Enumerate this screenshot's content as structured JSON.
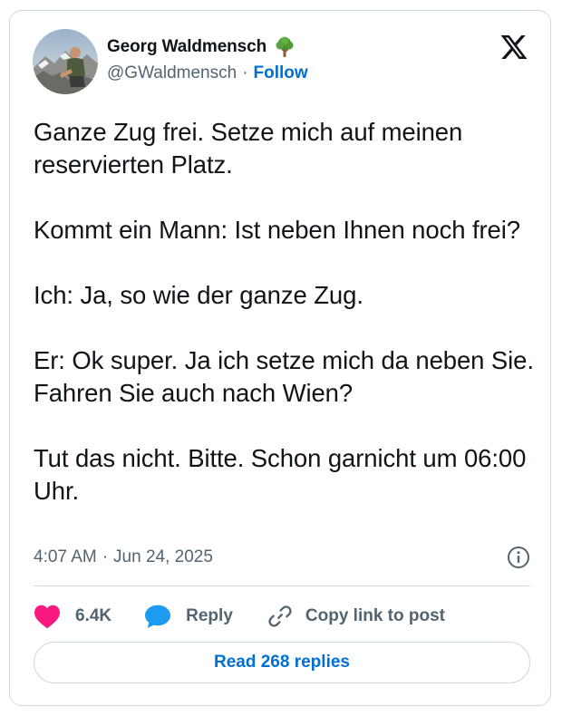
{
  "author": {
    "name": "Georg Waldmensch",
    "name_emoji": "deciduous-tree-icon",
    "handle": "@GWaldmensch",
    "separator": "·",
    "follow_label": "Follow"
  },
  "tweet": {
    "paragraphs": [
      "Ganze Zug frei. Setze mich auf meinen reservierten Platz.",
      "Kommt ein Mann: Ist neben Ihnen noch frei?",
      "Ich: Ja, so wie der ganze Zug.",
      "Er: Ok super. Ja ich setze mich da neben Sie. Fahren Sie auch nach Wien?",
      "Tut das nicht. Bitte. Schon garnicht um 06:00 Uhr."
    ],
    "time": "4:07 AM",
    "separator": "·",
    "date": "Jun 24, 2025"
  },
  "actions": {
    "like_count": "6.4K",
    "reply_label": "Reply",
    "copy_label": "Copy link to post"
  },
  "read_replies_label": "Read 268 replies",
  "icons": {
    "platform": "x-logo-icon",
    "info": "info-icon",
    "like": "heart-icon",
    "reply": "speech-bubble-icon",
    "copy": "link-icon"
  },
  "colors": {
    "text": "#0f1419",
    "secondary": "#536471",
    "link": "#006fd6",
    "heart": "#f91880",
    "reply_bubble": "#1d9bf0",
    "border": "#cfd9de"
  }
}
